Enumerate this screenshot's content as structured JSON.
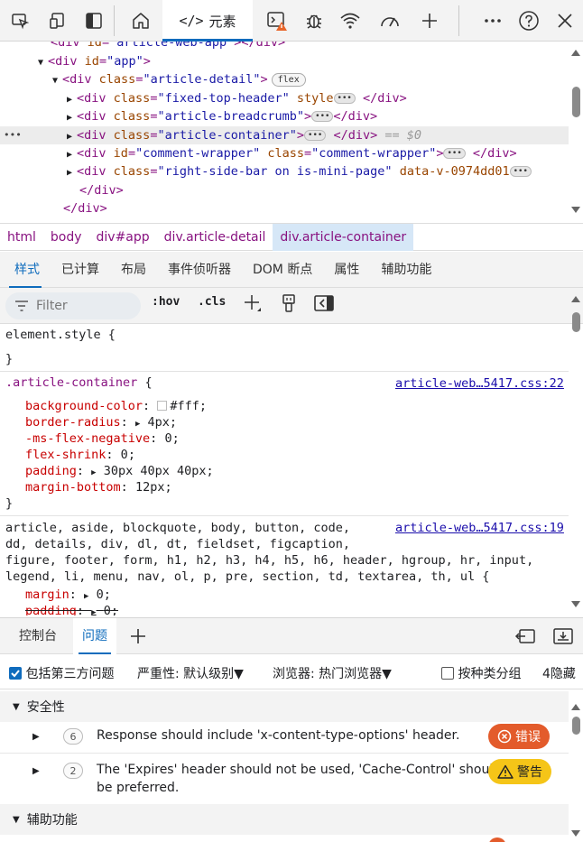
{
  "toolbar": {
    "elements_tab_label": "元素",
    "elements_tab_code": "</>"
  },
  "dom_tree": {
    "line0": {
      "open": "<",
      "tag": "div",
      "attr": "id",
      "val": "\"article-web-app\"",
      "close": "></",
      "tag2": "div",
      "end": ">"
    },
    "line1": {
      "open": "<",
      "tag": "div",
      "attr": "id",
      "val": "\"app\"",
      "end": ">"
    },
    "line2": {
      "tag": "div",
      "attr": "class",
      "val": "\"article-detail\"",
      "badge": "flex"
    },
    "line3": {
      "tag": "div",
      "attr": "class",
      "val": "\"fixed-top-header\"",
      "attr2": "style"
    },
    "line4": {
      "tag": "div",
      "attr": "class",
      "val": "\"article-breadcrumb\""
    },
    "line5": {
      "tag": "div",
      "attr": "class",
      "val": "\"article-container\"",
      "eq": "== $0",
      "gutter": "•••"
    },
    "line6": {
      "tag": "div",
      "attr": "id",
      "val": "\"comment-wrapper\"",
      "attr2": "class",
      "val2": "\"comment-wrapper\""
    },
    "line7": {
      "tag": "div",
      "attr": "class",
      "val": "\"right-side-bar on is-mini-page\"",
      "attr2": "data-v-0974dd01"
    },
    "line8": {
      "text": "</div>"
    },
    "line9": {
      "text": "</div>"
    }
  },
  "breadcrumb": [
    "html",
    "body",
    "div#app",
    "div.article-detail",
    "div.article-container"
  ],
  "styles_tabs": [
    "样式",
    "已计算",
    "布局",
    "事件侦听器",
    "DOM 断点",
    "属性",
    "辅助功能"
  ],
  "filter": {
    "placeholder": "Filter",
    "hov": ":hov",
    "cls": ".cls"
  },
  "styles": {
    "element_style_open": "element.style {",
    "element_style_close": "}",
    "rule1": {
      "selector": ".article-container",
      "brace": " {",
      "source": "article-web…5417.css:22",
      "props": [
        {
          "name": "background-color",
          "value": "#fff",
          "swatch": "#ffffff"
        },
        {
          "name": "border-radius",
          "value": "4px",
          "expand": true
        },
        {
          "name": "-ms-flex-negative",
          "value": "0"
        },
        {
          "name": "flex-shrink",
          "value": "0"
        },
        {
          "name": "padding",
          "value": "30px 40px 40px",
          "expand": true
        },
        {
          "name": "margin-bottom",
          "value": "12px"
        }
      ],
      "close": "}"
    },
    "rule2": {
      "selectors": [
        "article, aside, blockquote, body, button, code,",
        "dd, details, div, dl, dt, fieldset, figcaption,",
        "figure, footer, form, h1, h2, h3, h4, h5, h6, header, hgroup, hr, input,",
        "legend, li, menu, nav, ol, p, pre, section, td, textarea, th, ul {"
      ],
      "source": "article-web…5417.css:19",
      "props": [
        {
          "name": "margin",
          "value": "0"
        },
        {
          "name": "padding",
          "value": "0"
        }
      ]
    }
  },
  "drawer": {
    "tabs": [
      "控制台",
      "问题"
    ]
  },
  "issues_toolbar": {
    "third_party": "包括第三方问题",
    "severity": "严重性: 默认级别▼",
    "browser": "浏览器:  热门浏览器▼",
    "group_by": "按种类分组",
    "hidden": "4隐藏"
  },
  "issues": {
    "groups": [
      {
        "title": "安全性",
        "items": [
          {
            "count": "6",
            "text": "Response should include 'x-content-type-options' header.",
            "badge": "错误",
            "badge_color": "#e35b2b"
          },
          {
            "count": "2",
            "text": "The 'Expires' header should not be used, 'Cache-Control' should",
            "text2": "be preferred.",
            "badge": "警告",
            "badge_color": "#f5c518"
          }
        ]
      },
      {
        "title": "辅助功能"
      }
    ]
  },
  "colors": {
    "accent": "#0f6cbd",
    "error": "#e35b2b",
    "warning": "#f5c518"
  }
}
